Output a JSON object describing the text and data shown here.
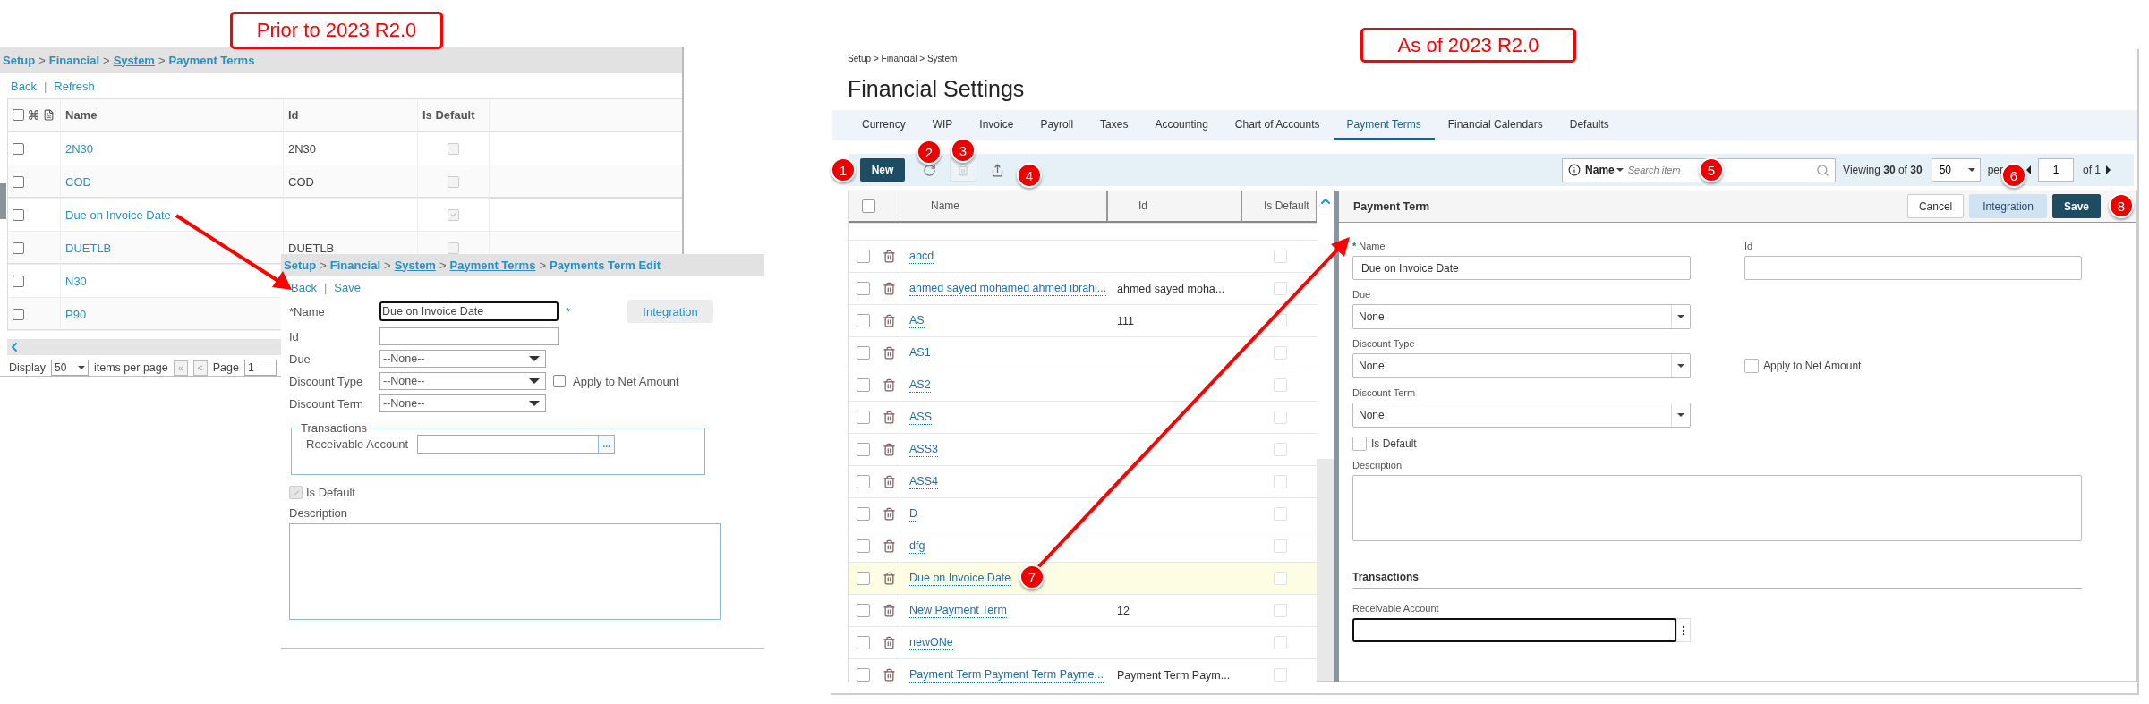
{
  "prior_label": "Prior to 2023 R2.0",
  "current_label": "As of 2023 R2.0",
  "old_list": {
    "breadcrumb": [
      {
        "label": "Setup",
        "link": false
      },
      {
        "sep": ">",
        "label": "Financial",
        "link": false
      },
      {
        "sep": ">",
        "label": "System",
        "link": true
      },
      {
        "sep": ">",
        "label": "Payment Terms",
        "link": false
      }
    ],
    "actions": [
      {
        "label": "Back"
      },
      {
        "sep": "|",
        "label": "Refresh"
      }
    ],
    "select_all_checked": false,
    "columns": [
      "Name",
      "Id",
      "Is Default"
    ],
    "rows": [
      {
        "name": "2N30",
        "id": "2N30",
        "is_default": false,
        "checked": false
      },
      {
        "name": "COD",
        "id": "COD",
        "is_default": false,
        "checked": false
      },
      {
        "name": "Due on Invoice Date",
        "is_default": true,
        "checked": false
      },
      {
        "name": "DUETLB",
        "id": "DUETLB",
        "is_default": false,
        "checked": false
      },
      {
        "name": "N30",
        "checked": false
      },
      {
        "name": "P90",
        "checked": false
      }
    ],
    "footer": {
      "display_label": "Display",
      "page_size": "50",
      "per_page_label": "items per page",
      "first": "«",
      "prev": "<",
      "page_label": "Page",
      "page": "1"
    }
  },
  "old_edit": {
    "breadcrumb": [
      {
        "label": "Setup",
        "link": false
      },
      {
        "sep": ">",
        "label": "Financial",
        "link": false
      },
      {
        "sep": ">",
        "label": "System",
        "link": true
      },
      {
        "sep": ">",
        "label": "Payment Terms",
        "link": true
      },
      {
        "sep": ">",
        "label": "Payments Term Edit",
        "link": false
      }
    ],
    "actions": [
      {
        "label": "Back"
      },
      {
        "sep": "|",
        "label": "Save"
      }
    ],
    "name": {
      "label": "*Name",
      "value": "Due on Invoice Date",
      "required_mark": "*"
    },
    "id_label": "Id",
    "integration": "Integration",
    "selects": [
      {
        "label": "Due",
        "value": "--None--"
      },
      {
        "label": "Discount Type",
        "value": "--None--"
      },
      {
        "label": "Discount Term",
        "value": "--None--"
      }
    ],
    "apply_net": {
      "label": "Apply to Net Amount",
      "checked": false
    },
    "transactions": {
      "legend": "Transactions",
      "account_label": "Receivable Account",
      "lookup": "..."
    },
    "is_default": {
      "label": "Is Default",
      "checked": true
    },
    "description_label": "Description"
  },
  "new_screen": {
    "breadcrumb": "Setup > Financial > System",
    "title": "Financial Settings",
    "tabs": [
      {
        "label": "Currency",
        "selected": false
      },
      {
        "label": "WIP",
        "selected": false
      },
      {
        "label": "Invoice",
        "selected": false
      },
      {
        "label": "Payroll",
        "selected": false
      },
      {
        "label": "Taxes",
        "selected": false
      },
      {
        "label": "Accounting",
        "selected": false
      },
      {
        "label": "Chart of Accounts",
        "selected": false
      },
      {
        "label": "Payment Terms",
        "selected": true
      },
      {
        "label": "Financial Calendars",
        "selected": false
      },
      {
        "label": "Defaults",
        "selected": false
      }
    ],
    "toolbar": {
      "new": "New",
      "delete_disabled": true
    },
    "search": {
      "field": "Name",
      "placeholder": "Search item"
    },
    "pager": {
      "viewing": "Viewing **30** of **30**",
      "page_size": "50",
      "per": "per",
      "page": "1",
      "of": "of 1"
    },
    "grid": {
      "select_all_checked": false,
      "columns": [
        "Name",
        "Id",
        "Is Default"
      ],
      "rows": [
        {
          "name": "abcd",
          "is_default": false,
          "checked": false,
          "selected": false
        },
        {
          "name": "ahmed sayed mohamed ahmed ibrahi...",
          "id": "ahmed sayed moha...",
          "is_default": false,
          "checked": false,
          "selected": false
        },
        {
          "name": "AS",
          "id": "111",
          "is_default": false,
          "checked": false,
          "selected": false
        },
        {
          "name": "AS1",
          "is_default": false,
          "checked": false,
          "selected": false
        },
        {
          "name": "AS2",
          "is_default": false,
          "checked": false,
          "selected": false
        },
        {
          "name": "ASS",
          "is_default": false,
          "checked": false,
          "selected": false
        },
        {
          "name": "ASS3",
          "is_default": false,
          "checked": false,
          "selected": false
        },
        {
          "name": "ASS4",
          "is_default": false,
          "checked": false,
          "selected": false
        },
        {
          "name": "D",
          "is_default": false,
          "checked": false,
          "selected": false
        },
        {
          "name": "dfg",
          "is_default": false,
          "checked": false,
          "selected": false
        },
        {
          "name": "Due on Invoice Date",
          "is_default": false,
          "checked": false,
          "selected": true
        },
        {
          "name": "New Payment Term",
          "id": "12",
          "is_default": false,
          "checked": false,
          "selected": false
        },
        {
          "name": "newONe",
          "is_default": false,
          "checked": false,
          "selected": false
        },
        {
          "name": "Payment Term Payment Term Payme...",
          "id": "Payment Term Paym...",
          "is_default": false,
          "checked": false,
          "selected": false
        }
      ]
    },
    "detail": {
      "title": "Payment Term",
      "buttons": [
        {
          "label": "Cancel",
          "kind": "secondary"
        },
        {
          "label": "Integration",
          "kind": "light"
        },
        {
          "label": "Save",
          "kind": "primary"
        }
      ],
      "name": {
        "required_mark": "*",
        "label": "Name",
        "value": "Due on Invoice Date"
      },
      "id_label": "Id",
      "selects": [
        {
          "label": "Due",
          "value": "None"
        },
        {
          "label": "Discount Type",
          "value": "None"
        },
        {
          "label": "Discount Term",
          "value": "None"
        }
      ],
      "apply_net": {
        "label": "Apply to Net Amount",
        "checked": false
      },
      "is_default": {
        "label": "Is Default",
        "checked": false
      },
      "description_label": "Description",
      "transactions_heading": "Transactions",
      "account_label": "Receivable Account"
    }
  },
  "badges": [
    "1",
    "2",
    "3",
    "4",
    "5",
    "6",
    "7",
    "8"
  ]
}
